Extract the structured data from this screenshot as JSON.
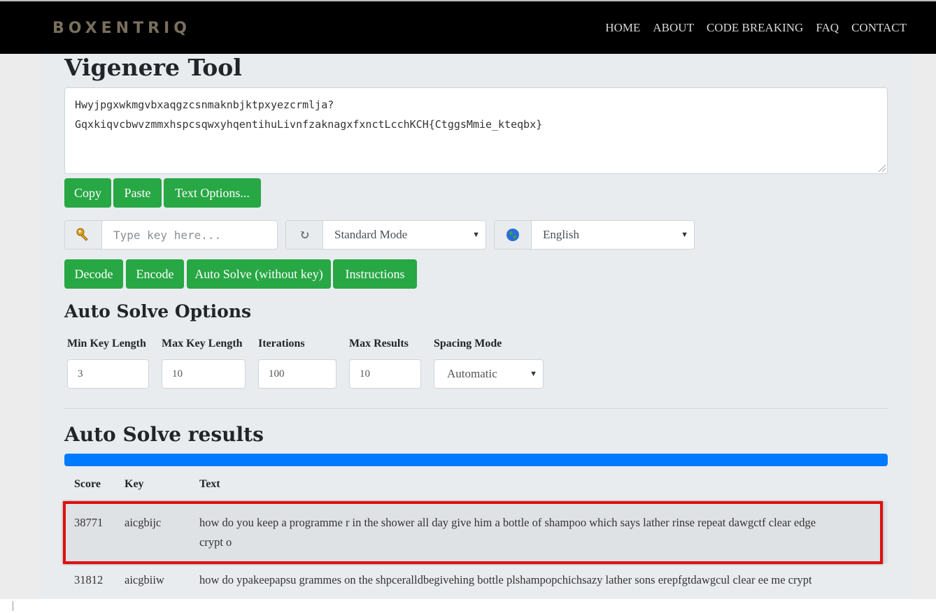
{
  "header": {
    "brand": "BOXENTRIQ",
    "nav": [
      "HOME",
      "ABOUT",
      "CODE BREAKING",
      "FAQ",
      "CONTACT"
    ]
  },
  "page": {
    "title": "Vigenere Tool",
    "ciphertext_line1": "Hwyjpgxwkmgvbxaqgzcsnmaknbjktpxyezcrmlja?",
    "ciphertext_line2": "GqxkiqvcbwvzmmxhspcsqwxyhqentihuLivnfzaknagxfxnctLcchKCH{CtggsMmie_kteqbx}"
  },
  "text_buttons": {
    "copy": "Copy",
    "paste": "Paste",
    "text_options": "Text Options..."
  },
  "key_input": {
    "placeholder": "Type key here...",
    "icon": "key-icon"
  },
  "mode_select": {
    "value": "Standard Mode",
    "icon": "refresh-icon"
  },
  "language_select": {
    "value": "English",
    "icon": "globe-icon"
  },
  "action_buttons": {
    "decode": "Decode",
    "encode": "Encode",
    "auto_solve": "Auto Solve (without key)",
    "instructions": "Instructions"
  },
  "auto_solve_options": {
    "heading": "Auto Solve Options",
    "min_key_length_label": "Min Key Length",
    "min_key_length": "3",
    "max_key_length_label": "Max Key Length",
    "max_key_length": "10",
    "iterations_label": "Iterations",
    "iterations": "100",
    "max_results_label": "Max Results",
    "max_results": "10",
    "spacing_mode_label": "Spacing Mode",
    "spacing_mode": "Automatic"
  },
  "results": {
    "heading": "Auto Solve results",
    "progress_percent": 100,
    "progress_color": "#007bff",
    "columns": [
      "Score",
      "Key",
      "Text"
    ],
    "rows": [
      {
        "score": "38771",
        "key": "aicgbijc",
        "text_line1": "how do you keep a programme r in the shower all day give him a bottle of shampoo which says lather rinse repeat dawgctf clear edge",
        "text_line2": "crypt o"
      },
      {
        "score": "31812",
        "key": "aicgbiiw",
        "text_line1": "how do ypakeepapsu grammes on the shpceralldbegivehing bottle plshampopchichsazy lather sons erepfgtdawgcul clear ee me crypt"
      }
    ]
  },
  "colors": {
    "button_green": "#28a745",
    "highlight_red": "#e01010",
    "header_bg": "#000000"
  }
}
